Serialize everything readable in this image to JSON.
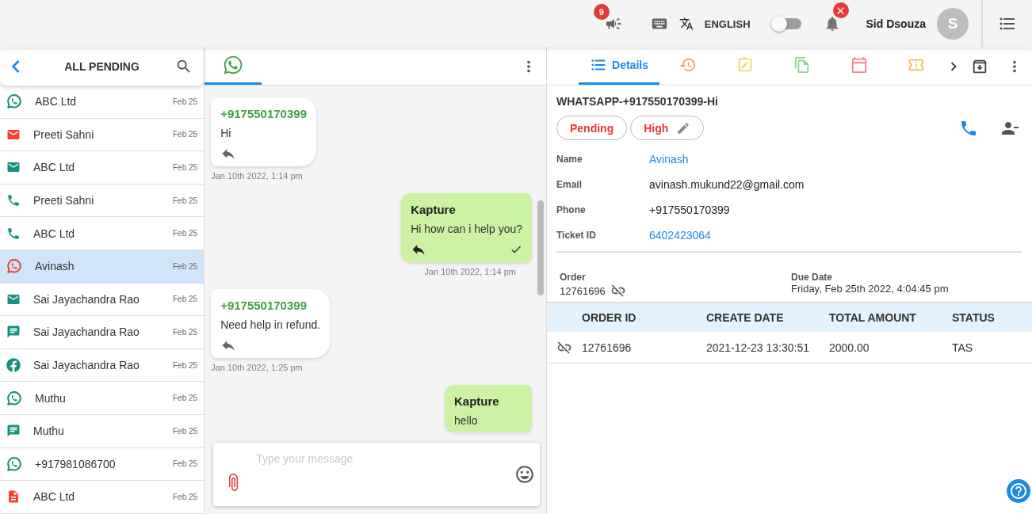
{
  "header": {
    "notifications_badge": "9",
    "language": "ENGLISH",
    "toggle": {
      "on": false
    },
    "alert_badge": true,
    "user_name": "Sid Dsouza",
    "avatar_initial": "S"
  },
  "inbox": {
    "title": "ALL PENDING",
    "items": [
      {
        "kind": "whatsapp",
        "name": "ABC Ltd",
        "date": "Feb 25",
        "selected": false,
        "color": "#17917f"
      },
      {
        "kind": "email",
        "name": "Preeti Sahni",
        "date": "Feb 25",
        "selected": false,
        "color": "#f44336"
      },
      {
        "kind": "email",
        "name": "ABC Ltd",
        "date": "Feb 25",
        "selected": false,
        "color": "#17917f"
      },
      {
        "kind": "phone",
        "name": "Preeti Sahni",
        "date": "Feb 25",
        "selected": false,
        "color": "#17917f"
      },
      {
        "kind": "phone",
        "name": "ABC Ltd",
        "date": "Feb 25",
        "selected": false,
        "color": "#17917f"
      },
      {
        "kind": "whatsapp",
        "name": "Avinash",
        "date": "Feb 25",
        "selected": true,
        "color": "#f44336"
      },
      {
        "kind": "email",
        "name": "Sai Jayachandra Rao",
        "date": "Feb 25",
        "selected": false,
        "color": "#17917f"
      },
      {
        "kind": "sms",
        "name": "Sai Jayachandra Rao",
        "date": "Feb 25",
        "selected": false,
        "color": "#17917f"
      },
      {
        "kind": "facebook",
        "name": "Sai Jayachandra Rao",
        "date": "Feb 25",
        "selected": false,
        "color": "#17917f"
      },
      {
        "kind": "whatsapp",
        "name": "Muthu",
        "date": "Feb 25",
        "selected": false,
        "color": "#17917f"
      },
      {
        "kind": "sms",
        "name": "Muthu",
        "date": "Feb 25",
        "selected": false,
        "color": "#17917f"
      },
      {
        "kind": "whatsapp",
        "name": "+917981086700",
        "date": "Feb 25",
        "selected": false,
        "color": "#17917f"
      },
      {
        "kind": "document",
        "name": "ABC Ltd",
        "date": "Feb 25",
        "selected": false,
        "color": "#f44336"
      }
    ]
  },
  "chat": {
    "tabs": [
      {
        "kind": "whatsapp",
        "selected": true
      }
    ],
    "messages": [
      {
        "kind": "incoming",
        "sender": "+917550170399",
        "text": "Hi",
        "time": "Jan 10th 2022, 1:14 pm"
      },
      {
        "kind": "outgoing",
        "sender": "Kapture",
        "text": "Hi how can i help you?",
        "time": "Jan 10th 2022, 1:14 pm",
        "delivered": true
      },
      {
        "kind": "incoming",
        "sender": "+917550170399",
        "text": "Need help in refund.",
        "time": "Jan 10th 2022, 1:25 pm"
      },
      {
        "kind": "outgoing",
        "sender": "Kapture",
        "text": "hello"
      }
    ],
    "composer": {
      "placeholder": "Type your message"
    }
  },
  "details": {
    "tabs": [
      {
        "kind": "details",
        "label": "Details",
        "selected": true
      },
      {
        "kind": "history",
        "selected": false,
        "color": "#f7a35c"
      },
      {
        "kind": "note",
        "selected": false,
        "color": "#f5d76e"
      },
      {
        "kind": "copy",
        "selected": false,
        "color": "#8fd49a"
      },
      {
        "kind": "calendar",
        "selected": false,
        "color": "#f08585"
      },
      {
        "kind": "ticket",
        "selected": false,
        "color": "#f7b955"
      }
    ],
    "title": "WHATSAPP-+917550170399-Hi",
    "chips": [
      {
        "label": "Pending",
        "editable": false
      },
      {
        "label": "High",
        "editable": true
      }
    ],
    "fields": [
      {
        "label": "Name",
        "value": "Avinash",
        "link": true
      },
      {
        "label": "Email",
        "value": "avinash.mukund22@gmail.com",
        "link": false
      },
      {
        "label": "Phone",
        "value": "+917550170399",
        "link": false
      },
      {
        "label": "Ticket ID",
        "value": "6402423064",
        "link": true
      }
    ],
    "order": {
      "label": "Order",
      "value": "12761696"
    },
    "due_date": {
      "label": "Due Date",
      "value": "Friday, Feb 25th 2022, 4:04:45 pm"
    },
    "table": {
      "columns": [
        "ORDER ID",
        "CREATE DATE",
        "TOTAL AMOUNT",
        "STATUS"
      ],
      "rows": [
        [
          "12761696",
          "2021-12-23 13:30:51",
          "2000.00",
          "TAS"
        ]
      ]
    }
  }
}
